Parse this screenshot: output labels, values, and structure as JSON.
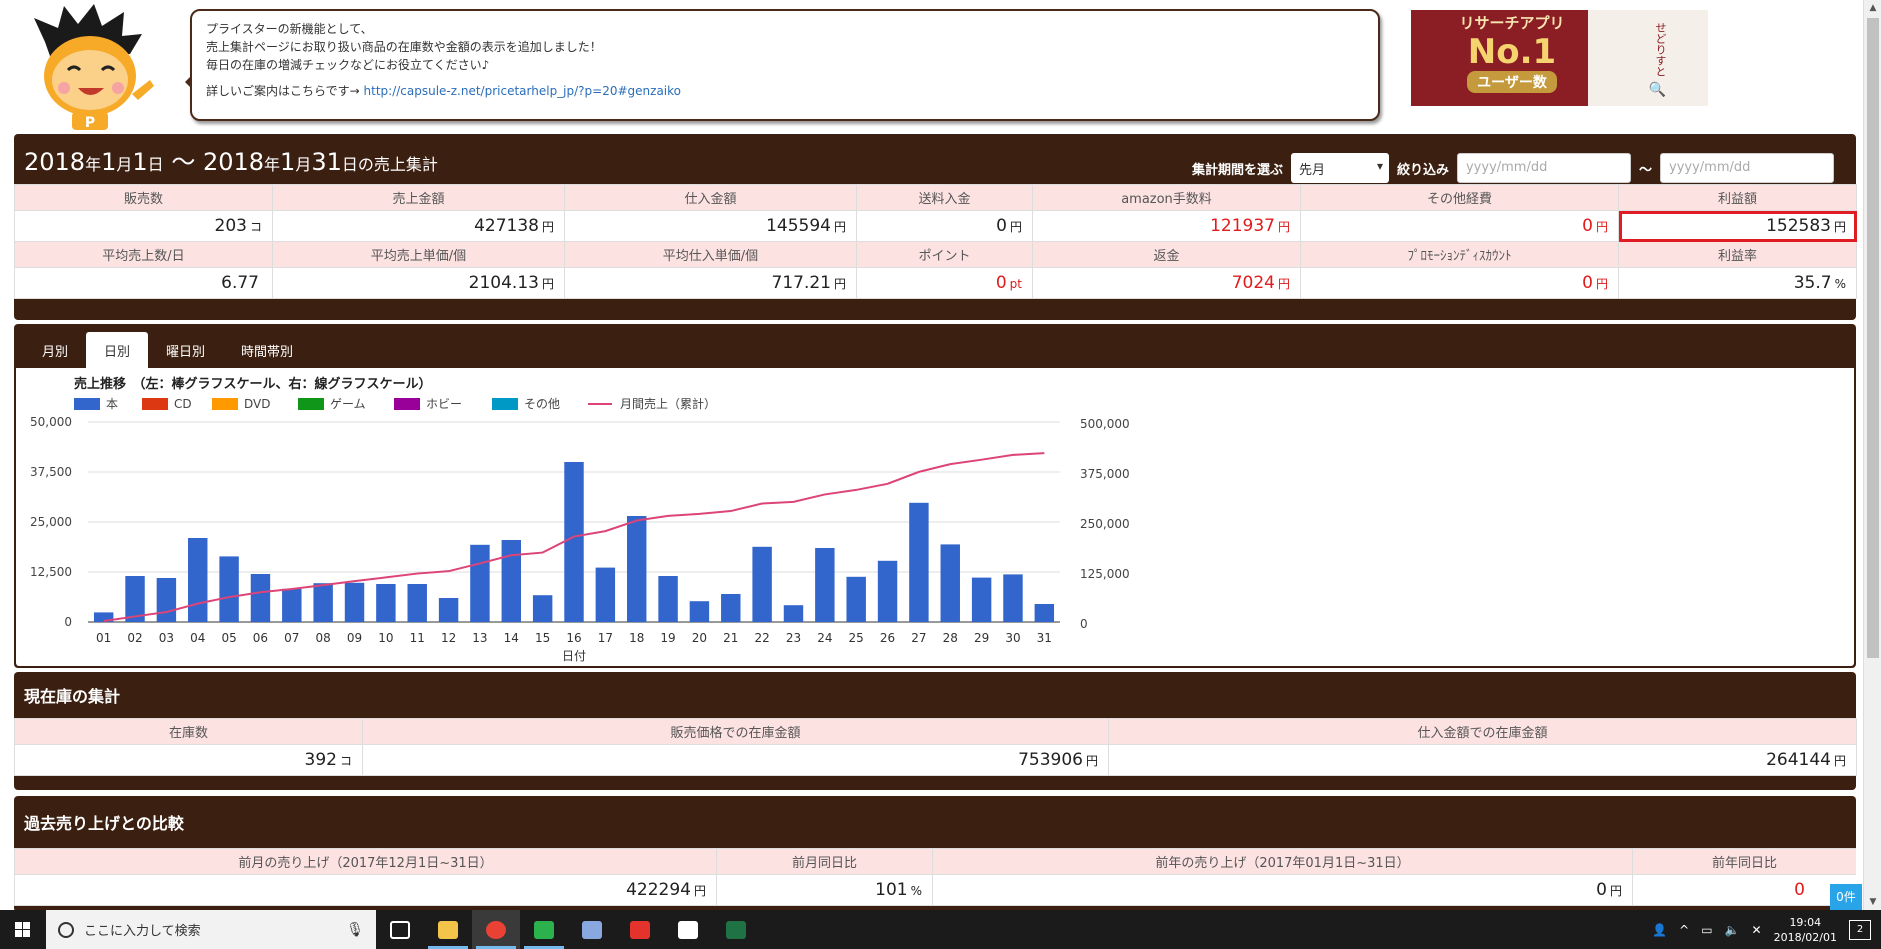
{
  "notice": {
    "lines": [
      "プライスターの新機能として、",
      "売上集計ページにお取り扱い商品の在庫数や金額の表示を追加しました！",
      "毎日の在庫の増減チェックなどにお役立てください♪"
    ],
    "more_label": "詳しいご案内はこちらです→ ",
    "more_link": "http://capsule-z.net/pricetarhelp_jp/?p=20#genzaiko"
  },
  "banner": {
    "line1": "リサーチアプリ",
    "line2": "No.1",
    "line3": "ユーザー数",
    "side": "せどりすと"
  },
  "period": {
    "title_parts": [
      [
        "2018",
        "年"
      ],
      [
        "1",
        "月"
      ],
      [
        "1",
        "日"
      ],
      [
        " ～ 2018",
        "年"
      ],
      [
        "1",
        "月"
      ],
      [
        "31",
        "日の売上集計"
      ]
    ],
    "filter_label": "集計期間を選ぶ",
    "select_value": "先月",
    "narrow_label": "絞り込み",
    "from_placeholder": "yyyy/mm/dd",
    "tilde": "～",
    "to_placeholder": "yyyy/mm/dd"
  },
  "stats_row1": [
    {
      "label": "販売数",
      "value": "203",
      "unit": "コ",
      "red": false
    },
    {
      "label": "売上金額",
      "value": "427138",
      "unit": "円",
      "red": false
    },
    {
      "label": "仕入金額",
      "value": "145594",
      "unit": "円",
      "red": false
    },
    {
      "label": "送料入金",
      "value": "0",
      "unit": "円",
      "red": false
    },
    {
      "label": "amazon手数料",
      "value": "121937",
      "unit": "円",
      "red": true
    },
    {
      "label": "その他経費",
      "value": "0",
      "unit": "円",
      "red": true
    },
    {
      "label": "利益額",
      "value": "152583",
      "unit": "円",
      "red": false
    }
  ],
  "stats_row2": [
    {
      "label": "平均売上数/日",
      "value": "6.77",
      "unit": "",
      "red": false
    },
    {
      "label": "平均売上単価/個",
      "value": "2104.13",
      "unit": "円",
      "red": false
    },
    {
      "label": "平均仕入単価/個",
      "value": "717.21",
      "unit": "円",
      "red": false
    },
    {
      "label": "ポイント",
      "value": "0",
      "unit": "pt",
      "red": true
    },
    {
      "label": "返金",
      "value": "7024",
      "unit": "円",
      "red": true
    },
    {
      "label": "ﾌﾟﾛﾓｰｼｮﾝﾃﾞｨｽｶｳﾝﾄ",
      "value": "0",
      "unit": "円",
      "red": true
    },
    {
      "label": "利益率",
      "value": "35.7",
      "unit": "%",
      "red": false
    }
  ],
  "tabs": [
    {
      "label": "月別"
    },
    {
      "label": "日別"
    },
    {
      "label": "曜日別"
    },
    {
      "label": "時間帯別"
    }
  ],
  "active_tab": "日別",
  "chart_data": {
    "type": "bar",
    "title": "売上推移　（左：棒グラフスケール、右：線グラフスケール）",
    "xlabel": "日付",
    "categories": [
      "01",
      "02",
      "03",
      "04",
      "05",
      "06",
      "07",
      "08",
      "09",
      "10",
      "11",
      "12",
      "13",
      "14",
      "15",
      "16",
      "17",
      "18",
      "19",
      "20",
      "21",
      "22",
      "23",
      "24",
      "25",
      "26",
      "27",
      "28",
      "29",
      "30",
      "31"
    ],
    "legend": [
      {
        "name": "本",
        "color": "#3366cc"
      },
      {
        "name": "CD",
        "color": "#dc3912"
      },
      {
        "name": "DVD",
        "color": "#ff9900"
      },
      {
        "name": "ゲーム",
        "color": "#109618"
      },
      {
        "name": "ホビー",
        "color": "#990099"
      },
      {
        "name": "その他",
        "color": "#0099c6"
      },
      {
        "name": "月間売上（累計）",
        "color": "#dd4477"
      }
    ],
    "series": [
      {
        "name": "本",
        "type": "bar",
        "axis": "left",
        "values": [
          2400,
          11500,
          11000,
          21000,
          16400,
          12000,
          8300,
          9700,
          9800,
          9500,
          9500,
          6000,
          19300,
          20500,
          6700,
          40000,
          13600,
          26500,
          11500,
          5200,
          7000,
          18800,
          4200,
          18500,
          11300,
          15300,
          29800,
          19400,
          11100,
          11900,
          4500
        ]
      },
      {
        "name": "月間売上（累計）",
        "type": "line",
        "axis": "right",
        "values": [
          2400,
          13900,
          24900,
          45900,
          62300,
          74300,
          82600,
          92300,
          102100,
          111600,
          121100,
          127100,
          146400,
          166900,
          173600,
          213600,
          227200,
          253700,
          265200,
          270400,
          277400,
          296200,
          300400,
          318900,
          330200,
          345500,
          375300,
          394700,
          405800,
          417700,
          422200
        ]
      }
    ],
    "y_left": {
      "ylim": [
        0,
        50000
      ],
      "ticks": [
        "0",
        "12,500",
        "25,000",
        "37,500",
        "50,000"
      ]
    },
    "y_right": {
      "ylim": [
        0,
        500000
      ],
      "ticks": [
        "0",
        "125,000",
        "250,000",
        "375,000",
        "500,000"
      ]
    }
  },
  "inventory": {
    "title": "現在庫の集計",
    "headers": [
      "在庫数",
      "販売価格での在庫金額",
      "仕入金額での在庫金額"
    ],
    "values": [
      {
        "value": "392",
        "unit": "コ"
      },
      {
        "value": "753906",
        "unit": "円"
      },
      {
        "value": "264144",
        "unit": "円"
      }
    ]
  },
  "compare": {
    "title": "過去売り上げとの比較",
    "headers": [
      "前月の売り上げ（2017年12月1日~31日）",
      "前月同日比",
      "前年の売り上げ（2017年01月1日~31日）",
      "前年同日比"
    ],
    "values": [
      {
        "value": "422294",
        "unit": "円",
        "red": false
      },
      {
        "value": "101",
        "unit": "%",
        "red": false
      },
      {
        "value": "0",
        "unit": "円",
        "red": false
      },
      {
        "value": "0",
        "unit": "",
        "red": true
      }
    ],
    "badge": "0件"
  },
  "taskbar": {
    "search_placeholder": "ここに入力して検索",
    "time": "19:04",
    "date": "2018/02/01",
    "notif_count": "2",
    "apps": [
      "task-view-icon",
      "file-explorer-icon",
      "chrome-icon",
      "line-icon",
      "app-icon",
      "game-icon",
      "book-icon",
      "excel-icon"
    ]
  }
}
